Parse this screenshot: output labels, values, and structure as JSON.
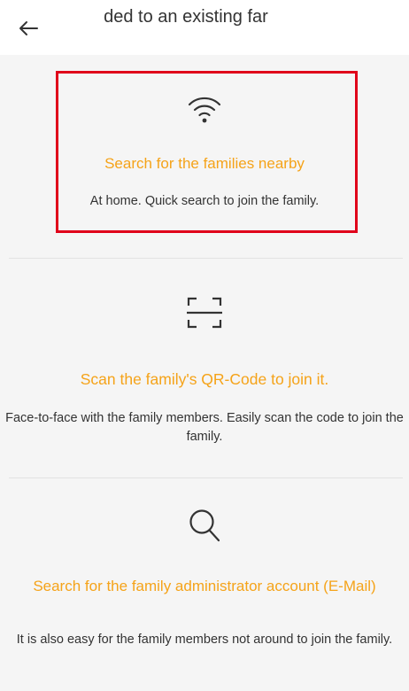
{
  "header": {
    "title": "dded to an existing far",
    "back_icon": "arrow-left-icon"
  },
  "options": [
    {
      "icon": "wifi-icon",
      "label": "Search for the families nearby",
      "description": "At home. Quick search to join the family."
    },
    {
      "icon": "qr-scan-icon",
      "label": "Scan the family's QR-Code to join it.",
      "description": "Face-to-face with the family members. Easily scan the code to join the family."
    },
    {
      "icon": "search-icon",
      "label": "Search for the family administrator account (E-Mail)",
      "description": "It is also easy for the family members not around to join the family."
    }
  ],
  "colors": {
    "accent": "#f5a319",
    "highlight": "#e0001a",
    "background": "#f5f5f5"
  }
}
